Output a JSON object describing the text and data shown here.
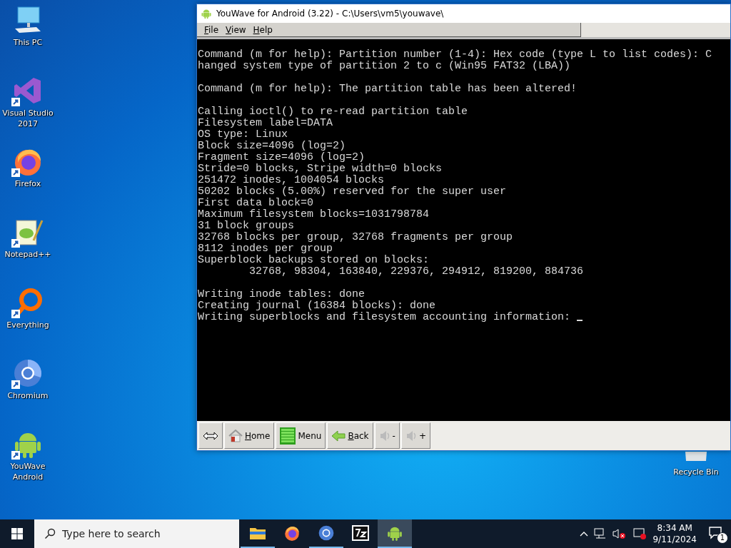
{
  "desktop_icons": [
    {
      "label": "This PC",
      "shortcut": false
    },
    {
      "label": "Visual Studio 2017",
      "shortcut": true
    },
    {
      "label": "Firefox",
      "shortcut": true
    },
    {
      "label": "Notepad++",
      "shortcut": true
    },
    {
      "label": "Everything",
      "shortcut": true
    },
    {
      "label": "Chromium",
      "shortcut": true
    },
    {
      "label": "YouWave Android",
      "shortcut": true
    }
  ],
  "recycle_bin": {
    "label": "Recycle Bin"
  },
  "window": {
    "title": "YouWave for Android (3.22) - C:\\Users\\vm5\\youwave\\",
    "menu": [
      "File",
      "View",
      "Help"
    ],
    "terminal": {
      "paragraphs": [
        [
          "Command (m for help): Partition number (1-4): Hex code (type L to list codes): C",
          "hanged system type of partition 2 to c (Win95 FAT32 (LBA))"
        ],
        [
          "Command (m for help): The partition table has been altered!"
        ],
        [
          "Calling ioctl() to re-read partition table",
          "Filesystem label=DATA",
          "OS type: Linux",
          "Block size=4096 (log=2)",
          "Fragment size=4096 (log=2)",
          "Stride=0 blocks, Stripe width=0 blocks",
          "251472 inodes, 1004054 blocks",
          "50202 blocks (5.00%) reserved for the super user",
          "First data block=0",
          "Maximum filesystem blocks=1031798784",
          "31 block groups",
          "32768 blocks per group, 32768 fragments per group",
          "8112 inodes per group",
          "Superblock backups stored on blocks:",
          "        32768, 98304, 163840, 229376, 294912, 819200, 884736"
        ],
        [
          "Writing inode tables: done",
          "Creating journal (16384 blocks): done",
          "Writing superblocks and filesystem accounting information: "
        ]
      ],
      "cursor": true
    },
    "toolbar": [
      {
        "kind": "resize"
      },
      {
        "kind": "home",
        "label": "Home"
      },
      {
        "kind": "menu",
        "label": "Menu"
      },
      {
        "kind": "back",
        "label": "Back"
      },
      {
        "kind": "volume",
        "label": "-"
      },
      {
        "kind": "volume",
        "label": "+"
      }
    ]
  },
  "taskbar": {
    "search": {
      "placeholder": "Type here to search"
    },
    "apps": [
      {
        "running": true,
        "selected": false
      },
      {
        "running": false,
        "selected": false
      },
      {
        "running": true,
        "selected": false
      },
      {
        "running": false,
        "selected": false
      },
      {
        "running": true,
        "selected": true
      }
    ],
    "time": "8:34 AM",
    "date": "9/11/2024",
    "notifications": "1"
  }
}
